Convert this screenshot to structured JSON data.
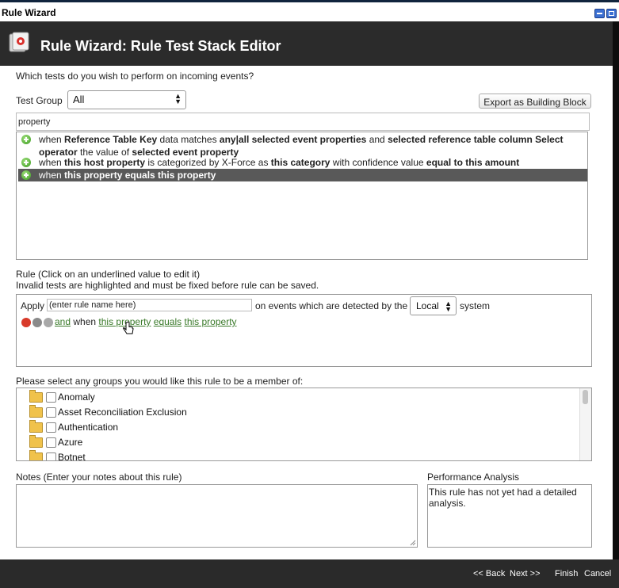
{
  "window": {
    "title": "Rule Wizard"
  },
  "header": {
    "title": "Rule Wizard: Rule Test Stack Editor"
  },
  "question": "Which tests do you wish to perform on incoming events?",
  "test_group": {
    "label": "Test Group",
    "value": "All"
  },
  "export_button": "Export as Building Block",
  "filter": {
    "value": "property"
  },
  "tests": [
    {
      "parts": [
        {
          "t": "when ",
          "b": false
        },
        {
          "t": "Reference Table Key",
          "b": true
        },
        {
          "t": " data matches ",
          "b": false
        },
        {
          "t": "any|all selected event properties",
          "b": true
        },
        {
          "t": " and ",
          "b": false
        },
        {
          "t": "selected reference table column",
          "b": true
        },
        {
          "t": " ",
          "b": false
        },
        {
          "t": "Select operator",
          "b": true
        },
        {
          "t": " the value of ",
          "b": false
        },
        {
          "t": "selected event property",
          "b": true
        }
      ]
    },
    {
      "parts": [
        {
          "t": "when ",
          "b": false
        },
        {
          "t": "this host property",
          "b": true
        },
        {
          "t": " is categorized by X-Force as ",
          "b": false
        },
        {
          "t": "this category",
          "b": true
        },
        {
          "t": " with confidence value ",
          "b": false
        },
        {
          "t": "equal to this amount",
          "b": true
        }
      ]
    },
    {
      "parts": [
        {
          "t": "when ",
          "b": false
        },
        {
          "t": "this property equals this property",
          "b": true
        }
      ],
      "selected": true
    }
  ],
  "rule": {
    "label": "Rule (Click on an underlined value to edit it)",
    "hint": "Invalid tests are highlighted and must be fixed before rule can be saved.",
    "apply_label": "Apply",
    "name_value": "(enter rule name here)",
    "detect_text": "on events which are detected by the",
    "system_value": "Local",
    "system_label": "system",
    "condition": {
      "and": "and",
      "when": "when",
      "prop1": "this property",
      "op": "equals",
      "prop2": "this property"
    }
  },
  "groups": {
    "label": "Please select any groups you would like this rule to be a member of:",
    "items": [
      "Anomaly",
      "Asset Reconciliation Exclusion",
      "Authentication",
      "Azure",
      "Botnet"
    ]
  },
  "notes": {
    "label": "Notes (Enter your notes about this rule)",
    "value": ""
  },
  "performance": {
    "label": "Performance Analysis",
    "text": "This rule has not yet had a detailed analysis."
  },
  "footer": {
    "back": "<< Back",
    "next": "Next >>",
    "finish": "Finish",
    "cancel": "Cancel"
  },
  "colors": {
    "header_bg": "#2b2b2b",
    "selected_row": "#595959",
    "link_green": "#3a7a2a"
  }
}
